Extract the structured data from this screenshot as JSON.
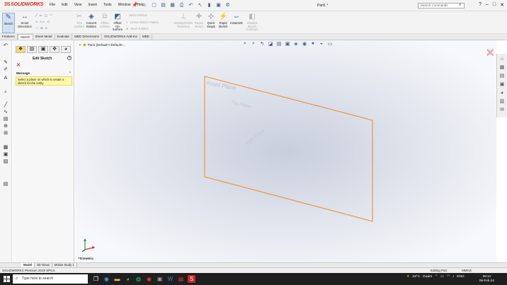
{
  "app": {
    "brand_prefix": "3S",
    "brand": "SOLIDWORKS",
    "doc_title": "Part1 *"
  },
  "menus": [
    "File",
    "Edit",
    "View",
    "Insert",
    "Tools",
    "Window",
    "Help"
  ],
  "search": {
    "placeholder": "Search Commands"
  },
  "commands": {
    "sketch": "Sketch",
    "smart_dimension": "Smart Dimension",
    "trim_entities": "Trim Entities",
    "convert_entities": "Convert Entities",
    "offset_entities": "Offset Entities",
    "offset_on_surface": "Offset On Surface",
    "mirror_entities": "Mirror Entities",
    "linear_sketch_pattern": "Linear Sketch Pattern",
    "move_entities": "Move Entities",
    "display_delete_relations": "Display/Delete Relations",
    "repair_sketch": "Repair Sketch",
    "quick_snaps": "Quick Snaps",
    "rapid_sketch": "Rapid Sketch",
    "instant2d": "Instant2D",
    "shaded_sketch_contours": "Shaded Sketch Contours"
  },
  "tabs": [
    "Features",
    "Sketch",
    "Sheet Metal",
    "Evaluate",
    "MBD Dimensions",
    "SOLIDWORKS Add-Ins",
    "MBD"
  ],
  "active_tab": "Sketch",
  "property_manager": {
    "title": "Edit Sketch",
    "message_header": "Message",
    "message": "Select a plane on which to create a sketch for the entity."
  },
  "viewport": {
    "tree_label": "Part1  (Default<<Default>...",
    "planes": [
      "Front Plane",
      "Top Plane",
      "Right Plane"
    ],
    "view_name": "*Trimetric",
    "plane_color": "#f0902a"
  },
  "model_tabs": [
    "Model",
    "3D Views",
    "Motion Study 1"
  ],
  "active_model_tab": "Model",
  "status": {
    "version": "SOLIDWORKS Premium 2019 SP0.0",
    "mode": "Editing Part",
    "units": "MMGS"
  },
  "taskbar": {
    "search_placeholder": "Type here to search",
    "weather": "23°C",
    "weather_desc": "Guam",
    "lang": "ENG",
    "time": "09:14",
    "date": "08-Feb-24"
  }
}
